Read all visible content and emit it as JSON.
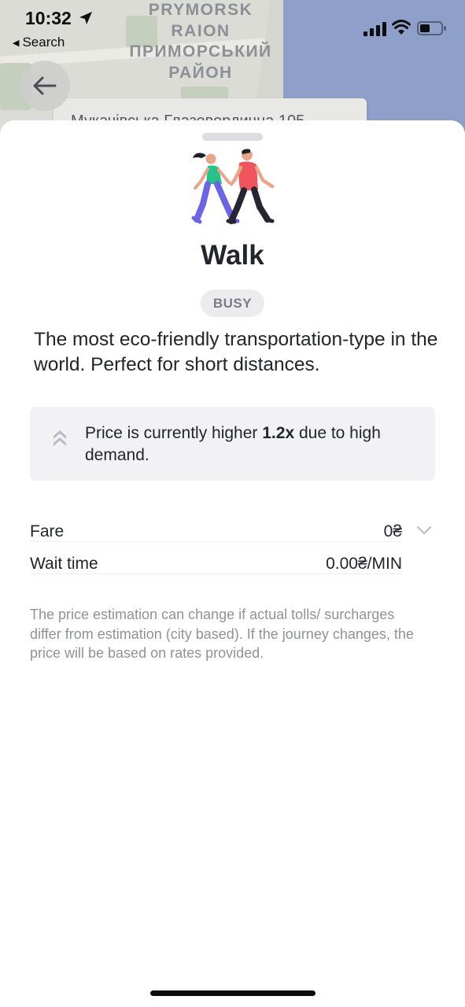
{
  "status_bar": {
    "time": "10:32",
    "back_app_label": "Search"
  },
  "map": {
    "district_label_line1": "PRYMORSK",
    "district_label_line2": "RAION",
    "district_label_line3": "ПРИМОРСЬКИЙ",
    "district_label_line4": "РАЙОН",
    "address_chip": "Мукачівська Глазовердична 105"
  },
  "sheet": {
    "title": "Walk",
    "badge": "BUSY",
    "description": "The most eco-friendly transportation-type in the world. Perfect for short distances.",
    "notice": {
      "text_before": "Price is currently higher ",
      "multiplier": "1.2x",
      "text_after": " due to high demand."
    },
    "fare": {
      "label": "Fare",
      "value": "0₴"
    },
    "wait_time": {
      "label": "Wait time",
      "value": "0.00₴/MIN"
    },
    "disclaimer": "The price estimation can change if actual tolls/ surcharges differ from estimation (city based). If the journey changes, the price will be based on rates provided."
  },
  "icons": {
    "back": "arrow-left-icon",
    "location": "location-arrow-icon",
    "surge": "double-chevron-up-icon",
    "expand": "chevron-down-icon"
  },
  "colors": {
    "text_primary": "#22252b",
    "text_secondary": "#8f9298",
    "badge_bg": "#ececef",
    "notice_bg": "#f2f2f4"
  }
}
